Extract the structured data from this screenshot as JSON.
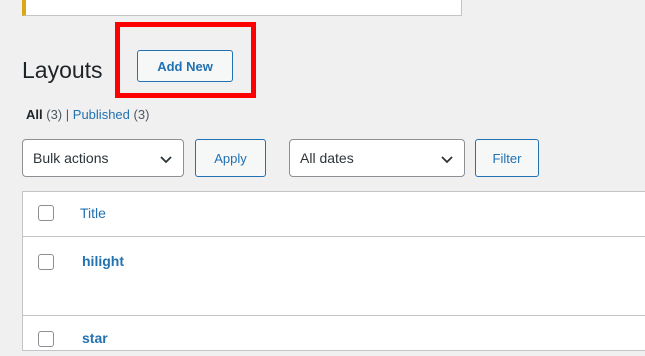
{
  "heading": {
    "title": "Layouts",
    "add_new": "Add New"
  },
  "filters": {
    "all_label": "All",
    "all_count": "(3)",
    "separator": "|",
    "published_label": "Published",
    "published_count": "(3)"
  },
  "toolbar": {
    "bulk_actions": "Bulk actions",
    "apply": "Apply",
    "dates": "All dates",
    "filter": "Filter"
  },
  "table": {
    "column_title": "Title",
    "rows": [
      {
        "title": "hilight"
      },
      {
        "title": "star"
      }
    ]
  },
  "colors": {
    "accent": "#2271b1",
    "highlight": "#ff0000",
    "notice_border": "#dba617"
  }
}
